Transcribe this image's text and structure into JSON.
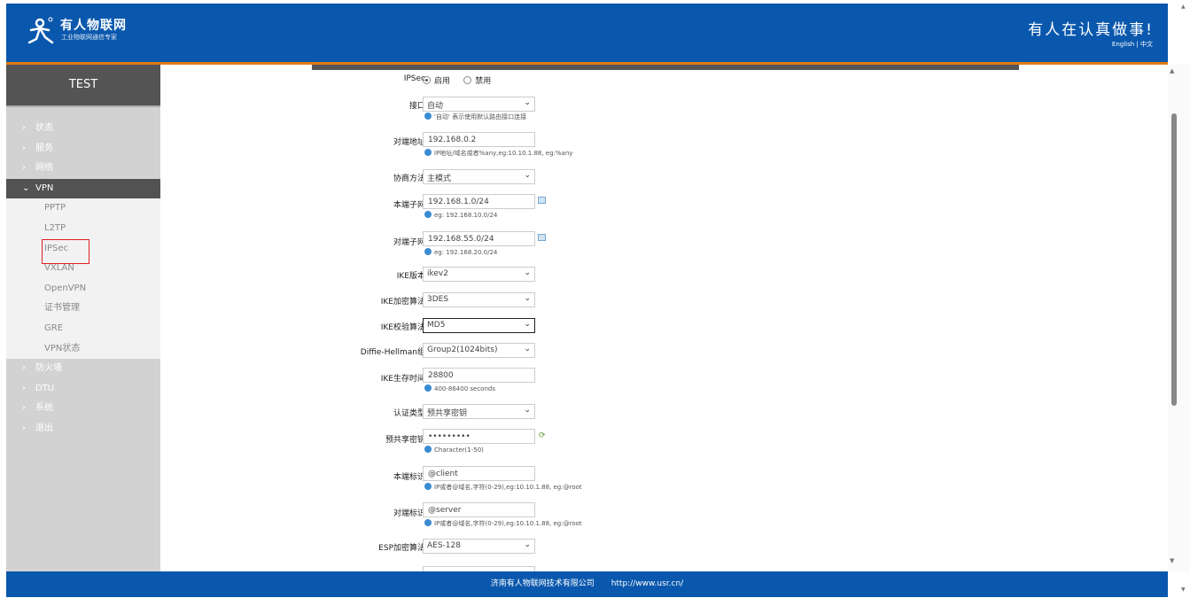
{
  "header": {
    "brand": "有人物联网",
    "brand_sub": "工业物联网通信专家",
    "slogan": "有人在认真做事!",
    "lang_en": "English",
    "lang_sep": "|",
    "lang_zh": "中文"
  },
  "sidebar": {
    "title": "TEST",
    "items": [
      {
        "label": "状态"
      },
      {
        "label": "服务"
      },
      {
        "label": "网络"
      },
      {
        "label": "VPN"
      },
      {
        "label": "防火墙"
      },
      {
        "label": "DTU"
      },
      {
        "label": "系统"
      },
      {
        "label": "退出"
      }
    ],
    "vpn_sub": [
      {
        "label": "PPTP"
      },
      {
        "label": "L2TP"
      },
      {
        "label": "IPSec"
      },
      {
        "label": "VXLAN"
      },
      {
        "label": "OpenVPN"
      },
      {
        "label": "证书管理"
      },
      {
        "label": "GRE"
      },
      {
        "label": "VPN状态"
      }
    ]
  },
  "form": {
    "ipsec": {
      "label": "IPSec",
      "opt_on": "启用",
      "opt_off": "禁用"
    },
    "iface": {
      "label": "接口",
      "value": "自动",
      "hint": "'自动' 表示使用默认路由接口连接"
    },
    "peer_addr": {
      "label": "对端地址",
      "value": "192.168.0.2",
      "hint": "IP地址/域名或者%any,eg:10.10.1.88, eg:%any"
    },
    "nego": {
      "label": "协商方法",
      "value": "主模式"
    },
    "local_subnet": {
      "label": "本端子网",
      "value": "192.168.1.0/24",
      "hint": "eg: 192.168.10.0/24"
    },
    "peer_subnet": {
      "label": "对端子网",
      "value": "192.168.55.0/24",
      "hint": "eg: 192.168.20.0/24"
    },
    "ike_ver": {
      "label": "IKE版本",
      "value": "ikev2"
    },
    "ike_enc": {
      "label": "IKE加密算法",
      "value": "3DES"
    },
    "ike_auth": {
      "label": "IKE校验算法",
      "value": "MD5"
    },
    "dh": {
      "label": "Diffie-Hellman组",
      "value": "Group2(1024bits)"
    },
    "ike_life": {
      "label": "IKE生存时间",
      "value": "28800",
      "hint": "400-86400 seconds"
    },
    "auth_type": {
      "label": "认证类型",
      "value": "预共享密钥"
    },
    "psk": {
      "label": "预共享密钥",
      "value": "•••••••••",
      "hint": "Character(1-50)"
    },
    "local_id": {
      "label": "本端标识",
      "value": "@client",
      "hint": "IP或者@域名,字符(0-29),eg:10.10.1.88, eg:@root"
    },
    "peer_id": {
      "label": "对端标识",
      "value": "@server",
      "hint": "IP或者@域名,字符(0-29),eg:10.10.1.88, eg:@root"
    },
    "esp_enc": {
      "label": "ESP加密算法",
      "value": "AES-128"
    }
  },
  "footer": {
    "company": "济南有人物联网技术有限公司",
    "url": "http://www.usr.cn/"
  },
  "colors": {
    "header_bg": "#0a58ad",
    "accent_line": "#e07a12",
    "sidebar_title_bg": "#545454",
    "sidebar_bg": "#d2d2d2",
    "highlight_box": "#e02020"
  }
}
